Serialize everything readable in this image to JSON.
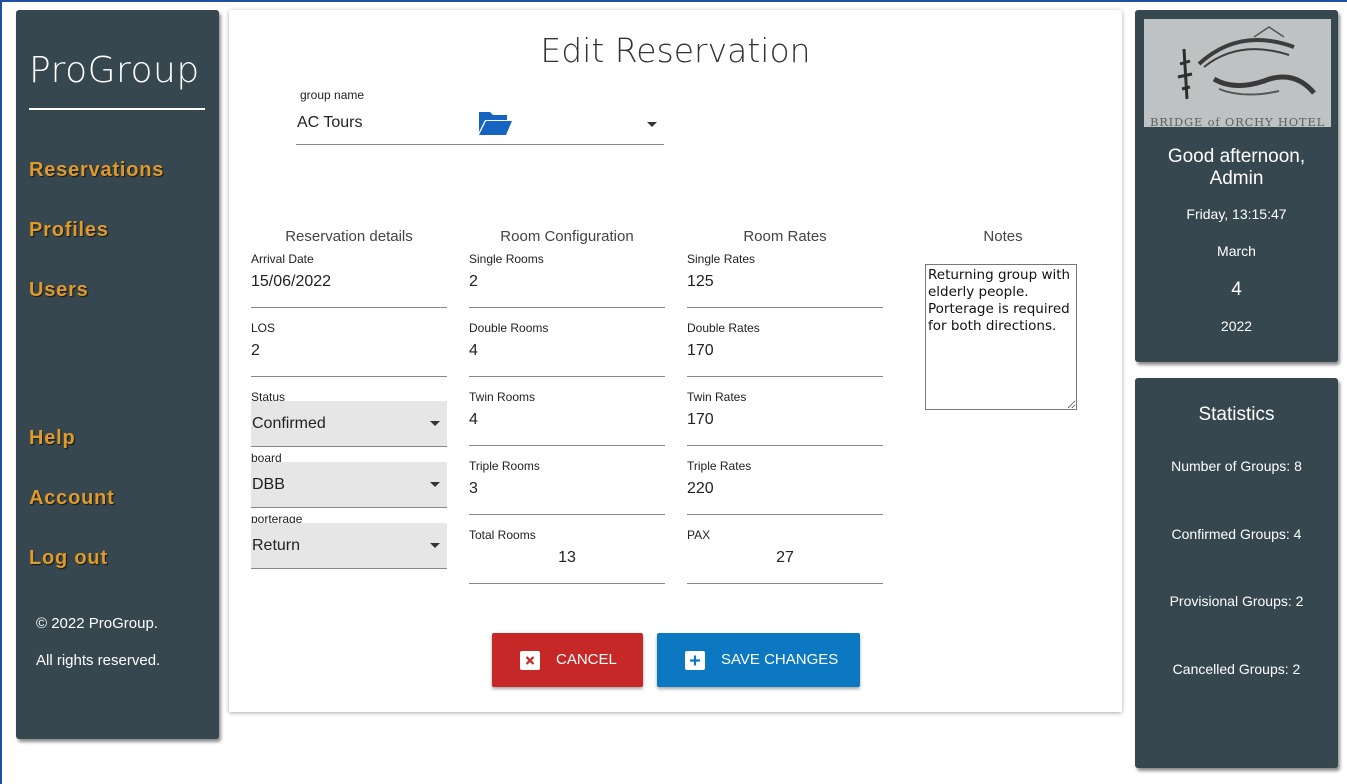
{
  "sidebar": {
    "brand": "ProGroup",
    "nav": [
      "Reservations",
      "Profiles",
      "Users",
      "Help",
      "Account",
      "Log out"
    ],
    "copyright": "© 2022 ProGroup.",
    "rights": "All rights reserved."
  },
  "form": {
    "title": "Edit Reservation",
    "group_label": "group name",
    "group_value": "AC Tours",
    "columns": {
      "details": "Reservation details",
      "rooms": "Room Configuration",
      "rates": "Room Rates",
      "notes": "Notes"
    },
    "arrival_label": "Arrival Date",
    "arrival_value": "15/06/2022",
    "los_label": "LOS",
    "los_value": "2",
    "status_label": "Status",
    "status_value": "Confirmed",
    "board_label": "board",
    "board_value": "DBB",
    "porterage_label": "porterage",
    "porterage_value": "Return",
    "single_rooms_label": "Single Rooms",
    "single_rooms_value": "2",
    "double_rooms_label": "Double Rooms",
    "double_rooms_value": "4",
    "twin_rooms_label": "Twin Rooms",
    "twin_rooms_value": "4",
    "triple_rooms_label": "Triple Rooms",
    "triple_rooms_value": "3",
    "total_rooms_label": "Total Rooms",
    "total_rooms_value": "13",
    "single_rates_label": "Single Rates",
    "single_rates_value": "125",
    "double_rates_label": "Double Rates",
    "double_rates_value": "170",
    "twin_rates_label": "Twin Rates",
    "twin_rates_value": "170",
    "triple_rates_label": "Triple Rates",
    "triple_rates_value": "220",
    "pax_label": "PAX",
    "pax_value": "27",
    "notes_value": "Returning group with elderly people. Porterage is required for both directions.",
    "cancel_label": "CANCEL",
    "save_label": "SAVE CHANGES"
  },
  "greeting": {
    "logo_text": "BRIDGE of ORCHY HOTEL",
    "line1": "Good afternoon,",
    "line2": "Admin",
    "datetime": "Friday, 13:15:47",
    "month": "March",
    "day": "4",
    "year": "2022"
  },
  "stats": {
    "title": "Statistics",
    "groups": "Number of Groups: 8",
    "confirmed": "Confirmed Groups: 4",
    "provisional": "Provisional Groups: 2",
    "cancelled": "Cancelled Groups: 2"
  },
  "colors": {
    "panel": "#37474f",
    "nav": "#e09a2a",
    "cancel": "#c62828",
    "save": "#0d78c2",
    "folder": "#1565c0"
  },
  "icons": [
    "folder-open-icon",
    "dropdown-caret-icon",
    "close-icon",
    "plus-icon",
    "hotel-logo"
  ]
}
